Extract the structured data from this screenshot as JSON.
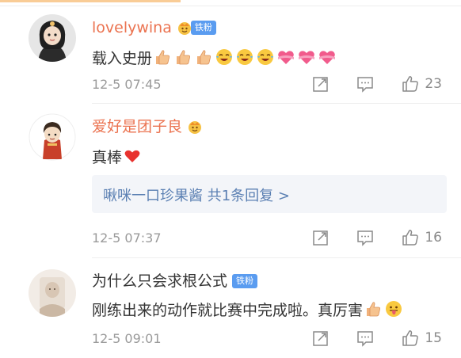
{
  "colors": {
    "username": "#eb7350",
    "link": "#5b80b3",
    "badge": "#5a9cf0",
    "time": "#9a9a9a"
  },
  "comments": [
    {
      "username": "lovelywina",
      "badge": "铁粉",
      "text": "载入史册",
      "emojis": [
        "thumbs-up",
        "thumbs-up",
        "thumbs-up",
        "crying-laughing",
        "crying-laughing",
        "crying-laughing",
        "heart-ribbon",
        "heart-ribbon",
        "heart-ribbon"
      ],
      "time": "12-5 07:45",
      "likes": "23"
    },
    {
      "username": "爱好是团子良",
      "text": "真棒",
      "emojis": [
        "red-heart"
      ],
      "reply_link": "啾咪一口珍果酱  共1条回复 >",
      "time": "12-5 07:37",
      "likes": "16"
    },
    {
      "username": "为什么只会求根公式",
      "badge": "铁粉",
      "text": "刚练出来的动作就比赛中完成啦。真厉害",
      "emojis": [
        "thumbs-up",
        "tongue-face"
      ],
      "time": "12-5 09:01",
      "likes": "15"
    }
  ]
}
